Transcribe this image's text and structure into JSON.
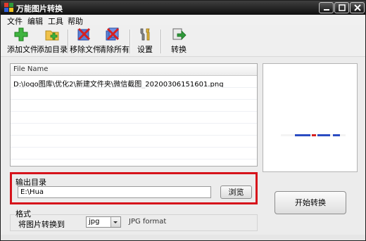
{
  "window": {
    "title": "万能图片转换"
  },
  "menu": [
    "文件",
    "编辑",
    "工具",
    "帮助"
  ],
  "toolbar": {
    "add_file": "添加文件",
    "add_dir": "添加目录",
    "remove_file": "移除文件",
    "clear_all": "清除所有",
    "settings": "设置",
    "convert": "转换"
  },
  "file_list": {
    "header": "File Name",
    "rows": [
      "D:\\logo图库\\优化2\\新建文件夹\\微信截图_20200306151601.png"
    ]
  },
  "output": {
    "label": "输出目录",
    "value": "E:\\Hua",
    "browse": "浏览"
  },
  "start_button": "开始转换",
  "format": {
    "title": "格式",
    "label": "将图片转换到",
    "selected": "jpg",
    "description": "JPG format"
  },
  "colors": {
    "highlight": "#d6131b",
    "titlebar": "#1a1a1a"
  }
}
